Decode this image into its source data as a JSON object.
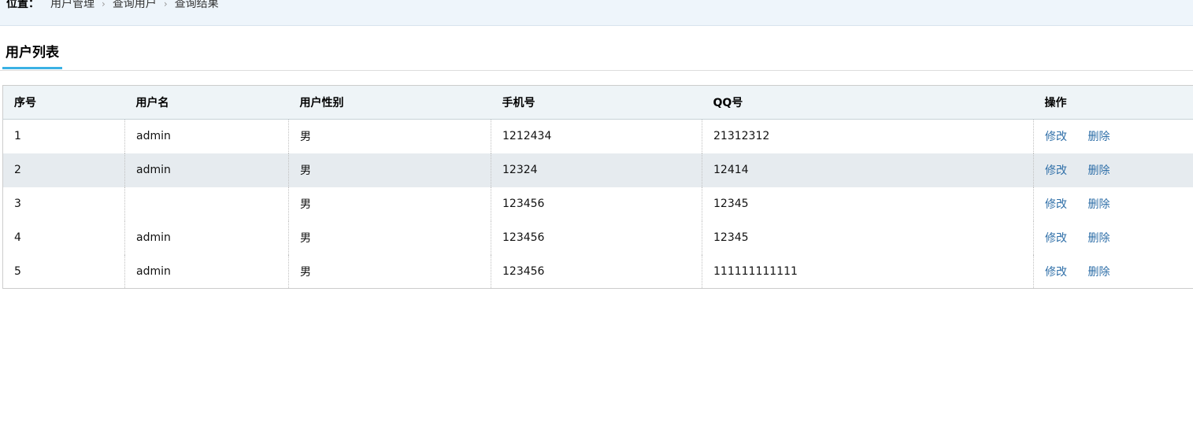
{
  "breadcrumb": {
    "prefix": "位置：",
    "items": [
      "用户管理",
      "查询用户",
      "查询结果"
    ],
    "separator": "›"
  },
  "page_title": "用户列表",
  "table": {
    "headers": [
      "序号",
      "用户名",
      "用户性别",
      "手机号",
      "QQ号",
      "操作"
    ],
    "rows": [
      {
        "id": "1",
        "username": "admin",
        "gender": "男",
        "phone": "1212434",
        "qq": "21312312"
      },
      {
        "id": "2",
        "username": "admin",
        "gender": "男",
        "phone": "12324",
        "qq": "12414"
      },
      {
        "id": "3",
        "username": "",
        "gender": "男",
        "phone": "123456",
        "qq": "12345"
      },
      {
        "id": "4",
        "username": "admin",
        "gender": "男",
        "phone": "123456",
        "qq": "12345"
      },
      {
        "id": "5",
        "username": "admin",
        "gender": "男",
        "phone": "123456",
        "qq": "111111111111"
      }
    ],
    "actions": {
      "edit": "修改",
      "delete": "删除"
    }
  },
  "colors": {
    "link": "#2f6fa8",
    "title_underline": "#3ab1e4",
    "breadcrumb_bg": "#eef5fb",
    "header_bg": "#eef4f7",
    "alt_row_bg": "#e6ebef"
  }
}
